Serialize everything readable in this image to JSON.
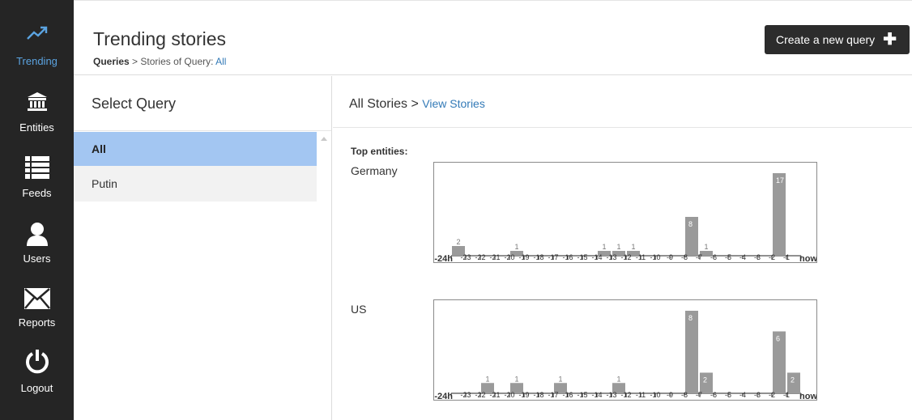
{
  "sidebar": {
    "items": [
      {
        "label": "Trending",
        "icon": "trending-icon",
        "active": true
      },
      {
        "label": "Entities",
        "icon": "bank-icon",
        "active": false
      },
      {
        "label": "Feeds",
        "icon": "list-icon",
        "active": false
      },
      {
        "label": "Users",
        "icon": "user-icon",
        "active": false
      },
      {
        "label": "Reports",
        "icon": "envelope-icon",
        "active": false
      },
      {
        "label": "Logout",
        "icon": "power-icon",
        "active": false
      }
    ]
  },
  "header": {
    "title": "Trending stories",
    "breadcrumb": {
      "root": "Queries",
      "sep": ">",
      "mid": "Stories of Query:",
      "current": "All"
    },
    "create_button": "Create a new query",
    "create_icon": "plus-icon"
  },
  "left_panel": {
    "heading": "Select Query",
    "queries": [
      {
        "label": "All",
        "selected": true
      },
      {
        "label": "Putin",
        "selected": false
      }
    ]
  },
  "right_panel": {
    "heading": "All Stories",
    "sep": ">",
    "link": "View Stories",
    "top_entities_label": "Top entities:"
  },
  "colors": {
    "sidebar_bg": "#252525",
    "active_nav": "#5ba3e0",
    "selected_query": "#a3c6f2",
    "bar": "#9a9a9a",
    "link": "#337ab7"
  },
  "chart_data": [
    {
      "type": "bar",
      "title": "Germany",
      "categories": [
        "-24h",
        "-23",
        "-22",
        "-21",
        "-20",
        "-19",
        "-18",
        "-17",
        "-16",
        "-15",
        "-14",
        "-13",
        "-12",
        "-11",
        "-10",
        "-9",
        "-8",
        "-7",
        "-6",
        "-5",
        "-4",
        "-3",
        "-2",
        "-1",
        "now"
      ],
      "values": [
        2,
        0,
        0,
        0,
        1,
        0,
        0,
        0,
        0,
        0,
        1,
        1,
        1,
        0,
        0,
        0,
        8,
        1,
        0,
        0,
        0,
        0,
        17,
        0
      ],
      "ymax": 17
    },
    {
      "type": "bar",
      "title": "US",
      "categories": [
        "-24h",
        "-23",
        "-22",
        "-21",
        "-20",
        "-19",
        "-18",
        "-17",
        "-16",
        "-15",
        "-14",
        "-13",
        "-12",
        "-11",
        "-10",
        "-9",
        "-8",
        "-7",
        "-6",
        "-5",
        "-4",
        "-3",
        "-2",
        "-1",
        "now"
      ],
      "values": [
        0,
        0,
        1,
        0,
        1,
        0,
        0,
        1,
        0,
        0,
        0,
        1,
        0,
        0,
        0,
        0,
        8,
        2,
        0,
        0,
        0,
        0,
        6,
        2
      ],
      "ymax": 8
    }
  ]
}
